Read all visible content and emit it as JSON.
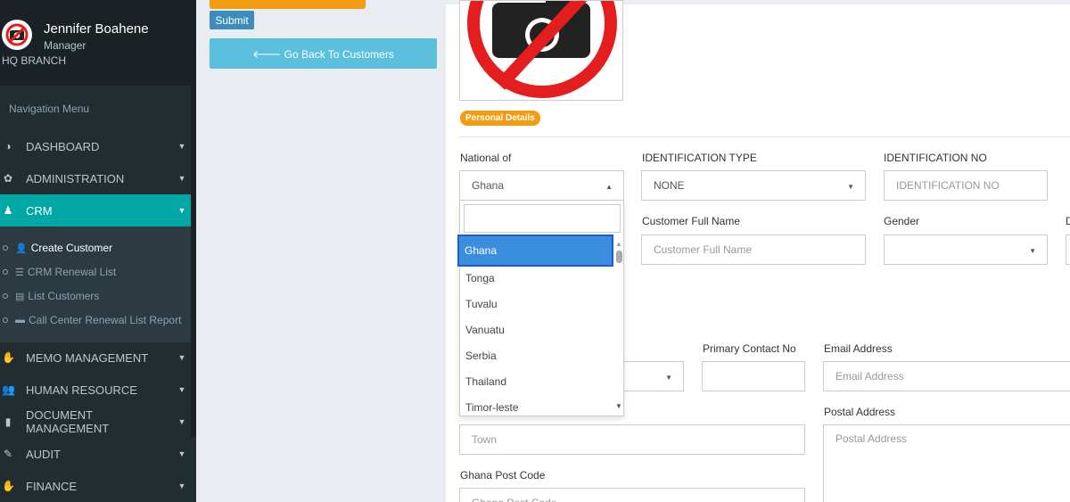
{
  "user": {
    "name": "Jennifer Boahene",
    "role": "Manager",
    "branch": "HQ BRANCH"
  },
  "sidebar": {
    "nav_header": "Navigation Menu",
    "menu": [
      {
        "label": "DASHBOARD",
        "icon": "dashboard-icon"
      },
      {
        "label": "ADMINISTRATION",
        "icon": "gear-icon"
      },
      {
        "label": "CRM",
        "icon": "user-icon"
      },
      {
        "label": "MEMO MANAGEMENT",
        "icon": "hand-icon"
      },
      {
        "label": "HUMAN RESOURCE",
        "icon": "users-icon"
      },
      {
        "label": "DOCUMENT MANAGEMENT",
        "icon": "document-icon"
      },
      {
        "label": "AUDIT",
        "icon": "pencil-icon"
      },
      {
        "label": "FINANCE",
        "icon": "hand-icon"
      }
    ],
    "crm_submenu": [
      {
        "label": "Create Customer",
        "icon": "user-plus-icon"
      },
      {
        "label": "CRM Renewal List",
        "icon": "list-icon"
      },
      {
        "label": "List Customers",
        "icon": "table-icon"
      },
      {
        "label": "Call Center Renewal List Report",
        "icon": "car-icon"
      }
    ]
  },
  "buttons": {
    "submit": "Submit",
    "back": "Go Back To Customers"
  },
  "section": {
    "personal_details": "Personal Details"
  },
  "form": {
    "national_of": {
      "label": "National of",
      "value": "Ghana"
    },
    "identification_type": {
      "label": "IDENTIFICATION TYPE",
      "value": "NONE"
    },
    "identification_no": {
      "label": "IDENTIFICATION NO",
      "placeholder": "IDENTIFICATION NO"
    },
    "customer_full_name": {
      "label": "Customer Full Name",
      "placeholder": "Customer Full Name"
    },
    "gender": {
      "label": "Gender"
    },
    "primary_contact": {
      "label": "Primary Contact No"
    },
    "email": {
      "label": "Email Address",
      "placeholder": "Email Address"
    },
    "town": {
      "placeholder": "Town"
    },
    "postal_address": {
      "label": "Postal Address",
      "placeholder": "Postal Address"
    },
    "ghana_post_code": {
      "label": "Ghana Post Code",
      "placeholder": "Ghana Post Code"
    }
  },
  "dropdown": {
    "options": [
      "Ghana",
      "Tonga",
      "Tuvalu",
      "Vanuatu",
      "Serbia",
      "Thailand",
      "Timor-leste"
    ],
    "selected": "Ghana"
  },
  "colors": {
    "sidebar_bg": "#222d32",
    "active_teal": "#00a7a5",
    "badge_orange": "#f39c12",
    "submit_blue": "#3c8dbc",
    "back_cyan": "#5bc0de",
    "selected_option": "#3b8de0"
  }
}
